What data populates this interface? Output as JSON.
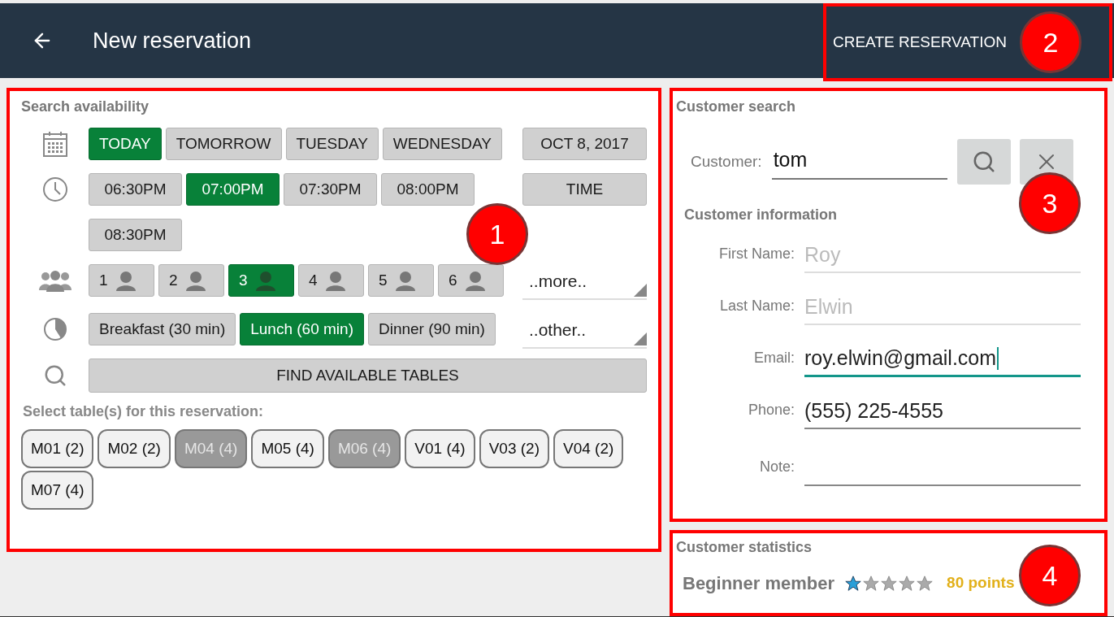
{
  "header": {
    "title": "New reservation",
    "action": "CREATE RESERVATION",
    "callout": "2"
  },
  "search_panel": {
    "title": "Search availability",
    "callout": "1",
    "dates": [
      {
        "label": "TODAY",
        "selected": true
      },
      {
        "label": "TOMORROW",
        "selected": false
      },
      {
        "label": "TUESDAY",
        "selected": false
      },
      {
        "label": "WEDNESDAY",
        "selected": false
      }
    ],
    "date_picker": "OCT 8, 2017",
    "times": [
      {
        "label": "06:30PM",
        "selected": false
      },
      {
        "label": "07:00PM",
        "selected": true
      },
      {
        "label": "07:30PM",
        "selected": false
      },
      {
        "label": "08:00PM",
        "selected": false
      },
      {
        "label": "08:30PM",
        "selected": false
      }
    ],
    "time_picker": "TIME",
    "party_sizes": [
      {
        "label": "1",
        "selected": false
      },
      {
        "label": "2",
        "selected": false
      },
      {
        "label": "3",
        "selected": true
      },
      {
        "label": "4",
        "selected": false
      },
      {
        "label": "5",
        "selected": false
      },
      {
        "label": "6",
        "selected": false
      }
    ],
    "more_select": "..more..",
    "durations": [
      {
        "label": "Breakfast (30 min)",
        "selected": false
      },
      {
        "label": "Lunch (60 min)",
        "selected": true
      },
      {
        "label": "Dinner (90 min)",
        "selected": false
      }
    ],
    "other_select": "..other..",
    "find_button": "FIND AVAILABLE TABLES",
    "tables_label": "Select table(s) for this reservation:",
    "tables": [
      {
        "label": "M01 (2)",
        "available": true
      },
      {
        "label": "M02 (2)",
        "available": true
      },
      {
        "label": "M04 (4)",
        "available": false
      },
      {
        "label": "M05 (4)",
        "available": true
      },
      {
        "label": "M06 (4)",
        "available": false
      },
      {
        "label": "V01 (4)",
        "available": true
      },
      {
        "label": "V03 (2)",
        "available": true
      },
      {
        "label": "V04 (2)",
        "available": true
      },
      {
        "label": "M07 (4)",
        "available": true
      }
    ]
  },
  "customer_panel": {
    "title": "Customer search",
    "callout": "3",
    "customer": {
      "label": "Customer:",
      "value": "tom"
    },
    "info_title": "Customer information",
    "fields": [
      {
        "label": "First Name:",
        "value": "Roy",
        "disabled": true,
        "focused": false
      },
      {
        "label": "Last Name:",
        "value": "Elwin",
        "disabled": true,
        "focused": false
      },
      {
        "label": "Email:",
        "value": "roy.elwin@gmail.com",
        "disabled": false,
        "focused": true
      },
      {
        "label": "Phone:",
        "value": "(555) 225-4555",
        "disabled": false,
        "focused": false
      },
      {
        "label": "Note:",
        "disabled": false,
        "focused": false
      }
    ]
  },
  "statistics_panel": {
    "title": "Customer statistics",
    "callout": "4",
    "membership": "Beginner member",
    "stars": 1,
    "points": "80 points"
  }
}
